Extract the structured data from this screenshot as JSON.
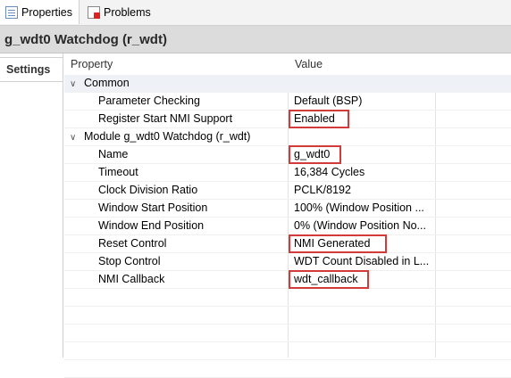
{
  "tabs": {
    "properties_label": "Properties",
    "problems_label": "Problems"
  },
  "title": "g_wdt0 Watchdog (r_wdt)",
  "sidebar": {
    "settings_label": "Settings"
  },
  "table": {
    "header_property": "Property",
    "header_value": "Value",
    "group_common": "Common",
    "group_module": "Module g_wdt0 Watchdog (r_wdt)",
    "rows": [
      {
        "property": "Parameter Checking",
        "value": "Default (BSP)"
      },
      {
        "property": "Register Start NMI Support",
        "value": "Enabled"
      },
      {
        "property": "Name",
        "value": "g_wdt0"
      },
      {
        "property": "Timeout",
        "value": "16,384 Cycles"
      },
      {
        "property": "Clock Division Ratio",
        "value": "PCLK/8192"
      },
      {
        "property": "Window Start Position",
        "value": "100% (Window Position ..."
      },
      {
        "property": "Window End Position",
        "value": "0% (Window Position No..."
      },
      {
        "property": "Reset Control",
        "value": "NMI Generated"
      },
      {
        "property": "Stop Control",
        "value": "WDT Count Disabled in L..."
      },
      {
        "property": "NMI Callback",
        "value": "wdt_callback"
      }
    ]
  },
  "colors": {
    "highlight": "#d33a3a",
    "group_bg": "#eef1f6"
  }
}
